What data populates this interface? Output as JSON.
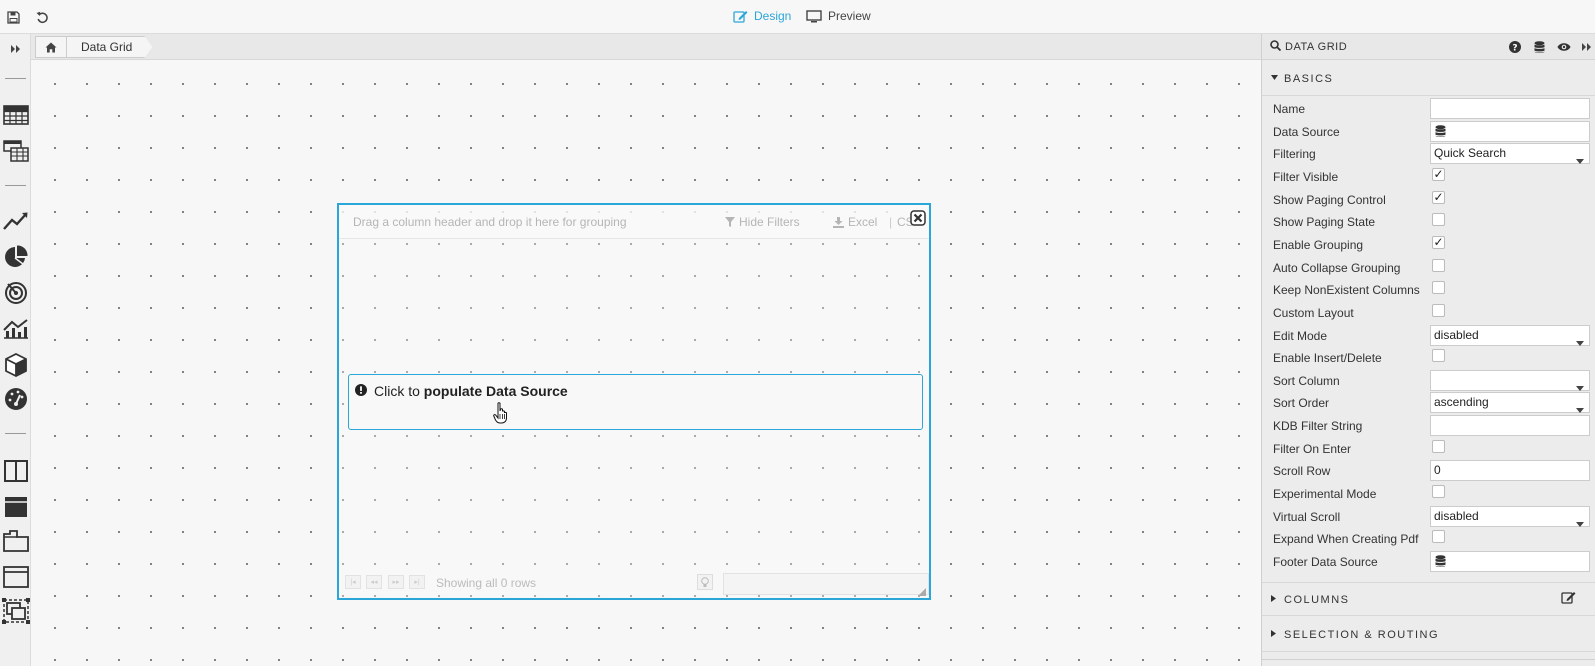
{
  "topbar": {
    "design_label": "Design",
    "preview_label": "Preview",
    "accent_color": "#2ba6d9"
  },
  "breadcrumb": {
    "items": [
      "Data Grid"
    ]
  },
  "widget": {
    "group_hint": "Drag a column header and drop it here for grouping",
    "hide_filters": "Hide Filters",
    "excel": "Excel",
    "separator": "|",
    "csv": "CSV",
    "populate_prefix": "Click to ",
    "populate_bold": "populate Data Source",
    "showing": "Showing all 0 rows"
  },
  "panel": {
    "title": "DATA GRID",
    "sections": {
      "basics": "BASICS",
      "columns": "COLUMNS",
      "selection": "SELECTION & ROUTING"
    },
    "props": [
      {
        "label": "Name",
        "type": "input",
        "value": ""
      },
      {
        "label": "Data Source",
        "type": "db",
        "value": ""
      },
      {
        "label": "Filtering",
        "type": "select",
        "value": "Quick Search"
      },
      {
        "label": "Filter Visible",
        "type": "check",
        "value": "✓"
      },
      {
        "label": "Show Paging Control",
        "type": "check",
        "value": "✓"
      },
      {
        "label": "Show Paging State",
        "type": "check",
        "value": ""
      },
      {
        "label": "Enable Grouping",
        "type": "check",
        "value": "✓"
      },
      {
        "label": "Auto Collapse Grouping",
        "type": "check",
        "value": ""
      },
      {
        "label": "Keep NonExistent Columns",
        "type": "check",
        "value": ""
      },
      {
        "label": "Custom Layout",
        "type": "check",
        "value": ""
      },
      {
        "label": "Edit Mode",
        "type": "select",
        "value": "disabled"
      },
      {
        "label": "Enable Insert/Delete",
        "type": "check",
        "value": ""
      },
      {
        "label": "Sort Column",
        "type": "select",
        "value": ""
      },
      {
        "label": "Sort Order",
        "type": "select",
        "value": "ascending"
      },
      {
        "label": "KDB Filter String",
        "type": "input",
        "value": ""
      },
      {
        "label": "Filter On Enter",
        "type": "check",
        "value": ""
      },
      {
        "label": "Scroll Row",
        "type": "input",
        "value": "0"
      },
      {
        "label": "Experimental Mode",
        "type": "check",
        "value": ""
      },
      {
        "label": "Virtual Scroll",
        "type": "select",
        "value": "disabled"
      },
      {
        "label": "Expand When Creating Pdf",
        "type": "check",
        "value": ""
      },
      {
        "label": "Footer Data Source",
        "type": "db",
        "value": ""
      }
    ]
  },
  "left_toolbar": {
    "icons": [
      "data-grid-icon",
      "pivot-grid-icon",
      "line-chart-icon",
      "pie-chart-icon",
      "radar-chart-icon",
      "combo-chart-icon",
      "3d-chart-icon",
      "gauge-icon",
      "split-layout-icon",
      "header-layout-icon",
      "tab-layout-icon",
      "accordion-layout-icon",
      "overlay-layout-icon"
    ]
  }
}
